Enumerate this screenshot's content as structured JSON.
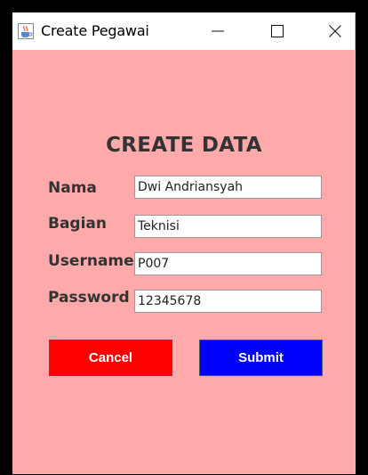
{
  "window": {
    "title": "Create Pegawai",
    "icon": "java-cup-icon"
  },
  "form": {
    "heading": "CREATE DATA",
    "fields": [
      {
        "label": "Nama",
        "value": "Dwi Andriansyah"
      },
      {
        "label": "Bagian",
        "value": "Teknisi"
      },
      {
        "label": "Username",
        "value": "P007"
      },
      {
        "label": "Password",
        "value": "12345678"
      }
    ]
  },
  "buttons": {
    "cancel_label": "Cancel",
    "submit_label": "Submit"
  },
  "colors": {
    "background": "#ffaaaa",
    "cancel": "#ff0000",
    "submit": "#0000ff",
    "text": "#333333"
  }
}
